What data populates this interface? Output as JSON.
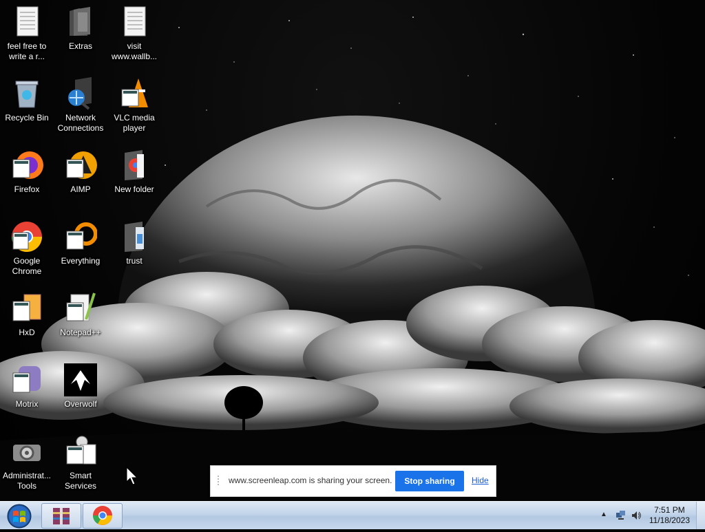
{
  "desktop": {
    "icons": [
      {
        "label": "feel free to write a r...",
        "icon": "text-document-icon"
      },
      {
        "label": "Extras",
        "icon": "folder-icon"
      },
      {
        "label": "visit www.wallb...",
        "icon": "text-document-icon"
      },
      {
        "label": "Recycle Bin",
        "icon": "recycle-bin-icon"
      },
      {
        "label": "Network Connections",
        "icon": "network-connections-icon"
      },
      {
        "label": "VLC media player",
        "icon": "vlc-icon"
      },
      {
        "label": "Firefox",
        "icon": "firefox-icon"
      },
      {
        "label": "AIMP",
        "icon": "aimp-icon"
      },
      {
        "label": "New folder",
        "icon": "folder-icon"
      },
      {
        "label": "Google Chrome",
        "icon": "chrome-icon"
      },
      {
        "label": "Everything",
        "icon": "everything-icon"
      },
      {
        "label": "trust",
        "icon": "folder-icon"
      },
      {
        "label": "HxD",
        "icon": "hxd-icon"
      },
      {
        "label": "Notepad++",
        "icon": "notepadpp-icon"
      },
      {
        "label": "Motrix",
        "icon": "motrix-icon"
      },
      {
        "label": "Overwolf",
        "icon": "overwolf-icon"
      },
      {
        "label": "Administrat... Tools",
        "icon": "admin-tools-icon"
      },
      {
        "label": "Smart Services",
        "icon": "smart-services-icon"
      }
    ]
  },
  "share_bar": {
    "message": "www.screenleap.com is sharing your screen.",
    "stop_label": "Stop sharing",
    "hide_label": "Hide"
  },
  "taskbar": {
    "time": "7:51 PM",
    "date": "11/18/2023"
  }
}
